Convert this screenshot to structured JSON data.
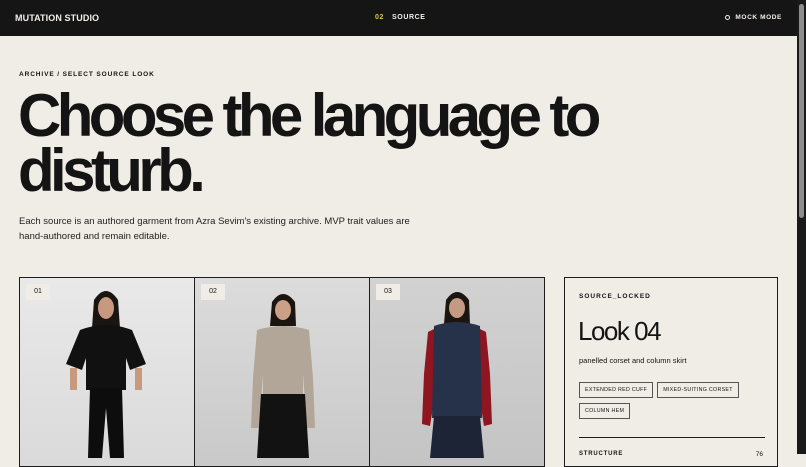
{
  "app": {
    "brand": "MUTATION STUDIO"
  },
  "nav": {
    "step_number": "02",
    "step_label": "SOURCE",
    "mode_label": "MOCK MODE"
  },
  "page": {
    "breadcrumb": "ARCHIVE / SELECT SOURCE LOOK",
    "headline": "Choose the language to disturb.",
    "intro": "Each source is an authored garment from Azra Sevim's existing archive. MVP trait values are hand-authored and remain editable."
  },
  "looks": [
    {
      "number": "01"
    },
    {
      "number": "02"
    },
    {
      "number": "03"
    }
  ],
  "panel": {
    "status": "SOURCE_LOCKED",
    "title": "Look 04",
    "subtitle": "panelled corset and column skirt",
    "tags": [
      "EXTENDED RED CUFF",
      "MIXED-SUITING CORSET",
      "COLUMN HEM"
    ],
    "stat_label": "STRUCTURE",
    "stat_value": "76"
  },
  "colors": {
    "background": "#f0ece6",
    "topbar": "#151515",
    "accent_step": "#d8c84a",
    "ink": "#141414"
  }
}
